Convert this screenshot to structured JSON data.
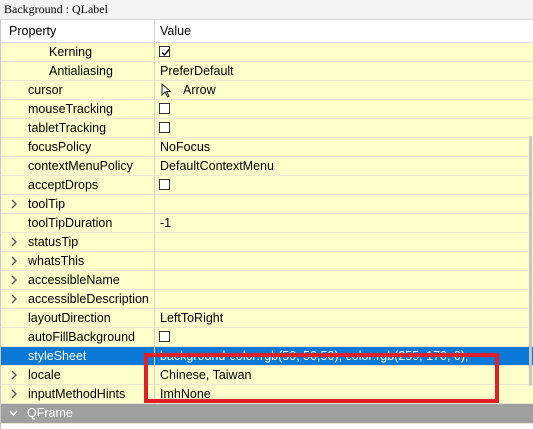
{
  "window": {
    "title": "Background : QLabel"
  },
  "header": {
    "property": "Property",
    "value": "Value"
  },
  "colors": {
    "row": "#ffffcc",
    "selected": "#0a78d7",
    "section": "#a0a0a0",
    "highlight_box": "#e02028"
  },
  "rows": [
    {
      "name": "Kerning",
      "indent": 2,
      "value_type": "checkbox",
      "checked": true
    },
    {
      "name": "Antialiasing",
      "indent": 2,
      "value": "PreferDefault"
    },
    {
      "name": "cursor",
      "indent": 1,
      "value": "Arrow",
      "icon": "arrow-cursor-icon"
    },
    {
      "name": "mouseTracking",
      "indent": 1,
      "value_type": "checkbox",
      "checked": false
    },
    {
      "name": "tabletTracking",
      "indent": 1,
      "value_type": "checkbox",
      "checked": false
    },
    {
      "name": "focusPolicy",
      "indent": 1,
      "value": "NoFocus"
    },
    {
      "name": "contextMenuPolicy",
      "indent": 1,
      "value": "DefaultContextMenu"
    },
    {
      "name": "acceptDrops",
      "indent": 1,
      "value_type": "checkbox",
      "checked": false
    },
    {
      "name": "toolTip",
      "indent": 1,
      "expandable": true,
      "value": ""
    },
    {
      "name": "toolTipDuration",
      "indent": 1,
      "value": "-1"
    },
    {
      "name": "statusTip",
      "indent": 1,
      "expandable": true,
      "value": ""
    },
    {
      "name": "whatsThis",
      "indent": 1,
      "expandable": true,
      "value": ""
    },
    {
      "name": "accessibleName",
      "indent": 1,
      "expandable": true,
      "value": ""
    },
    {
      "name": "accessibleDescription",
      "indent": 1,
      "expandable": true,
      "value": ""
    },
    {
      "name": "layoutDirection",
      "indent": 1,
      "value": "LeftToRight"
    },
    {
      "name": "autoFillBackground",
      "indent": 1,
      "value_type": "checkbox",
      "checked": false
    },
    {
      "name": "styleSheet",
      "indent": 1,
      "value": "background-color:rgb(50, 50,50); color:rgb(255, 170, 0);",
      "selected": true
    },
    {
      "name": "locale",
      "indent": 1,
      "expandable": true,
      "value": "Chinese, Taiwan"
    },
    {
      "name": "inputMethodHints",
      "indent": 1,
      "expandable": true,
      "value": "ImhNone"
    },
    {
      "name": "QFrame",
      "section": true
    }
  ]
}
